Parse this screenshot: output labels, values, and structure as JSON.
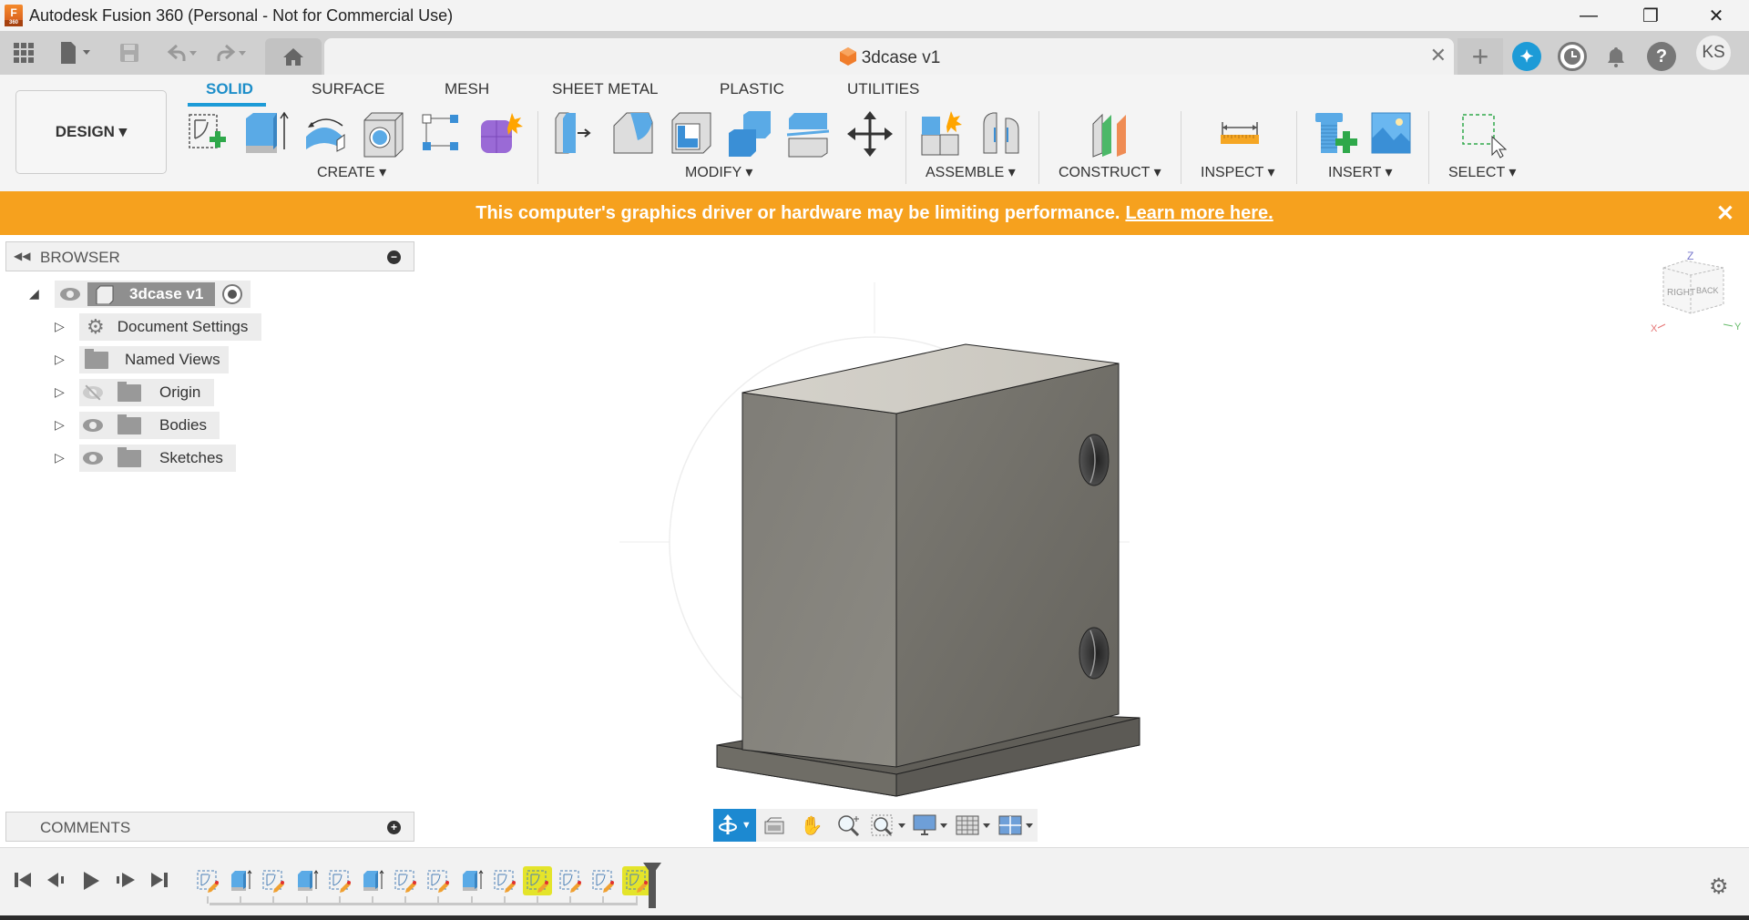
{
  "window": {
    "title": "Autodesk Fusion 360 (Personal - Not for Commercial Use)",
    "logo_letter": "F",
    "logo_sub": "360",
    "controls": {
      "minimize": "—",
      "restore": "❐",
      "close": "✕"
    }
  },
  "quick_access": {
    "icons": [
      "apps-grid-icon",
      "file-icon",
      "save-icon",
      "undo-icon",
      "redo-icon",
      "home-icon"
    ]
  },
  "document_tab": {
    "title": "3dcase v1",
    "close": "✕",
    "new_tab": "+"
  },
  "header_right": {
    "icons": [
      "extensions-icon",
      "job-status-icon",
      "notifications-icon",
      "help-icon"
    ],
    "avatar_initials": "KS"
  },
  "ribbon": {
    "workspace": "DESIGN ▾",
    "tabs": [
      {
        "label": "SOLID",
        "active": true
      },
      {
        "label": "SURFACE",
        "active": false
      },
      {
        "label": "MESH",
        "active": false
      },
      {
        "label": "SHEET METAL",
        "active": false
      },
      {
        "label": "PLASTIC",
        "active": false
      },
      {
        "label": "UTILITIES",
        "active": false
      }
    ],
    "groups": [
      {
        "label": "CREATE ▾",
        "tools": [
          "create-sketch",
          "extrude",
          "revolve",
          "hole",
          "pattern",
          "create-form"
        ]
      },
      {
        "label": "MODIFY ▾",
        "tools": [
          "press-pull",
          "fillet",
          "shell",
          "combine",
          "split-body",
          "move-copy"
        ]
      },
      {
        "label": "ASSEMBLE ▾",
        "tools": [
          "new-component",
          "joint"
        ]
      },
      {
        "label": "CONSTRUCT ▾",
        "tools": [
          "offset-plane"
        ]
      },
      {
        "label": "INSPECT ▾",
        "tools": [
          "measure"
        ]
      },
      {
        "label": "INSERT ▾",
        "tools": [
          "insert-mcmaster-carr",
          "insert-canvas"
        ]
      },
      {
        "label": "SELECT ▾",
        "tools": [
          "select"
        ]
      }
    ]
  },
  "banner": {
    "message": "This computer's graphics driver or hardware may be limiting performance.",
    "link": "Learn more here.",
    "close": "✕",
    "color": "#f6a11e"
  },
  "browser": {
    "title": "BROWSER",
    "root": {
      "label": "3dcase v1"
    },
    "items": [
      {
        "label": "Document Settings",
        "icon": "gear",
        "visibility": "none"
      },
      {
        "label": "Named Views",
        "icon": "folder",
        "visibility": "none"
      },
      {
        "label": "Origin",
        "icon": "folder",
        "visibility": "hidden"
      },
      {
        "label": "Bodies",
        "icon": "folder",
        "visibility": "visible"
      },
      {
        "label": "Sketches",
        "icon": "folder",
        "visibility": "visible"
      }
    ]
  },
  "comments": {
    "title": "COMMENTS"
  },
  "viewcube": {
    "faces": {
      "right": "RIGHT",
      "back": "BACK"
    },
    "axes": {
      "x": "X",
      "y": "Y",
      "z": "Z"
    }
  },
  "nav_toolbar": {
    "icons": [
      "orbit-icon",
      "look-at-icon",
      "pan-icon",
      "zoom-icon",
      "fit-icon",
      "display-settings-icon",
      "grid-settings-icon",
      "viewports-icon"
    ]
  },
  "timeline": {
    "playback": [
      "⏮",
      "◀",
      "▶",
      "▶",
      "⏭"
    ],
    "items": [
      {
        "type": "sketch",
        "highlighted": false
      },
      {
        "type": "extrude",
        "highlighted": false
      },
      {
        "type": "sketch",
        "highlighted": false
      },
      {
        "type": "extrude",
        "highlighted": false
      },
      {
        "type": "sketch",
        "highlighted": false
      },
      {
        "type": "extrude",
        "highlighted": false
      },
      {
        "type": "sketch",
        "highlighted": false
      },
      {
        "type": "sketch",
        "highlighted": false
      },
      {
        "type": "extrude",
        "highlighted": false
      },
      {
        "type": "sketch",
        "highlighted": false
      },
      {
        "type": "sketch",
        "highlighted": true
      },
      {
        "type": "sketch",
        "highlighted": false
      },
      {
        "type": "sketch",
        "highlighted": false
      },
      {
        "type": "sketch",
        "highlighted": true
      }
    ]
  }
}
